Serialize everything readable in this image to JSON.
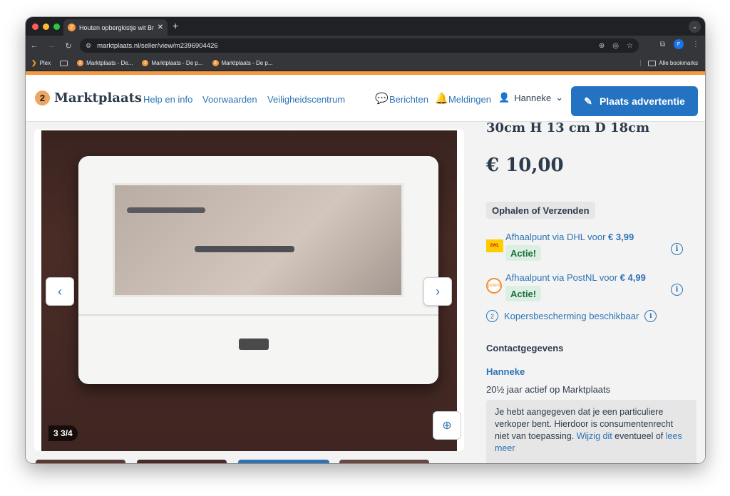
{
  "browser": {
    "tab_title": "Houten opbergkistje wit Br",
    "tab_icon": "marktplaats-favicon",
    "url": "marktplaats.nl/seller/view/m2396904426",
    "profile_initial": "F",
    "bookmarks": [
      {
        "label": "Plex"
      },
      {
        "label": ""
      },
      {
        "label": "Marktplaats - De..."
      },
      {
        "label": "Marktplaats - De p..."
      },
      {
        "label": "Marktplaats - De p..."
      }
    ],
    "all_bookmarks": "Alle bookmarks"
  },
  "header": {
    "logo_text": "Marktplaats",
    "links": [
      "Help en info",
      "Voorwaarden",
      "Veiligheidscentrum"
    ],
    "messages": "Berichten",
    "notifications": "Meldingen",
    "user": "Hanneke",
    "cta": "Plaats advertentie"
  },
  "gallery": {
    "counter": "3/4",
    "counter_prefix": "3"
  },
  "listing": {
    "title_tail": "30cm H 13 cm D 18cm",
    "price": "€ 10,00",
    "delivery": "Ophalen of Verzenden",
    "shipping": [
      {
        "carrier": "DHL",
        "text": "Afhaalpunt via DHL voor ",
        "price": "€ 3,99",
        "badge": "Actie!"
      },
      {
        "carrier": "postnl",
        "text": "Afhaalpunt via PostNL voor ",
        "price": "€ 4,99",
        "badge": "Actie!"
      }
    ],
    "buyer_protection": "Kopersbescherming beschikbaar",
    "contact_heading": "Contactgegevens",
    "seller_name": "Hanneke",
    "seller_active": "20½ jaar actief op Marktplaats",
    "notice_text": "Je hebt aangegeven dat je een particuliere verkoper bent. Hierdoor is consumentenrecht niet van toepassing.",
    "notice_link1": "Wijzig dit",
    "notice_mid": " eventueel of",
    "notice_link2": "lees meer"
  },
  "colors": {
    "brand_orange": "#f59a42",
    "link_blue": "#2d73b5",
    "cta_blue": "#2473c2",
    "text_dark": "#2d3c4d"
  }
}
